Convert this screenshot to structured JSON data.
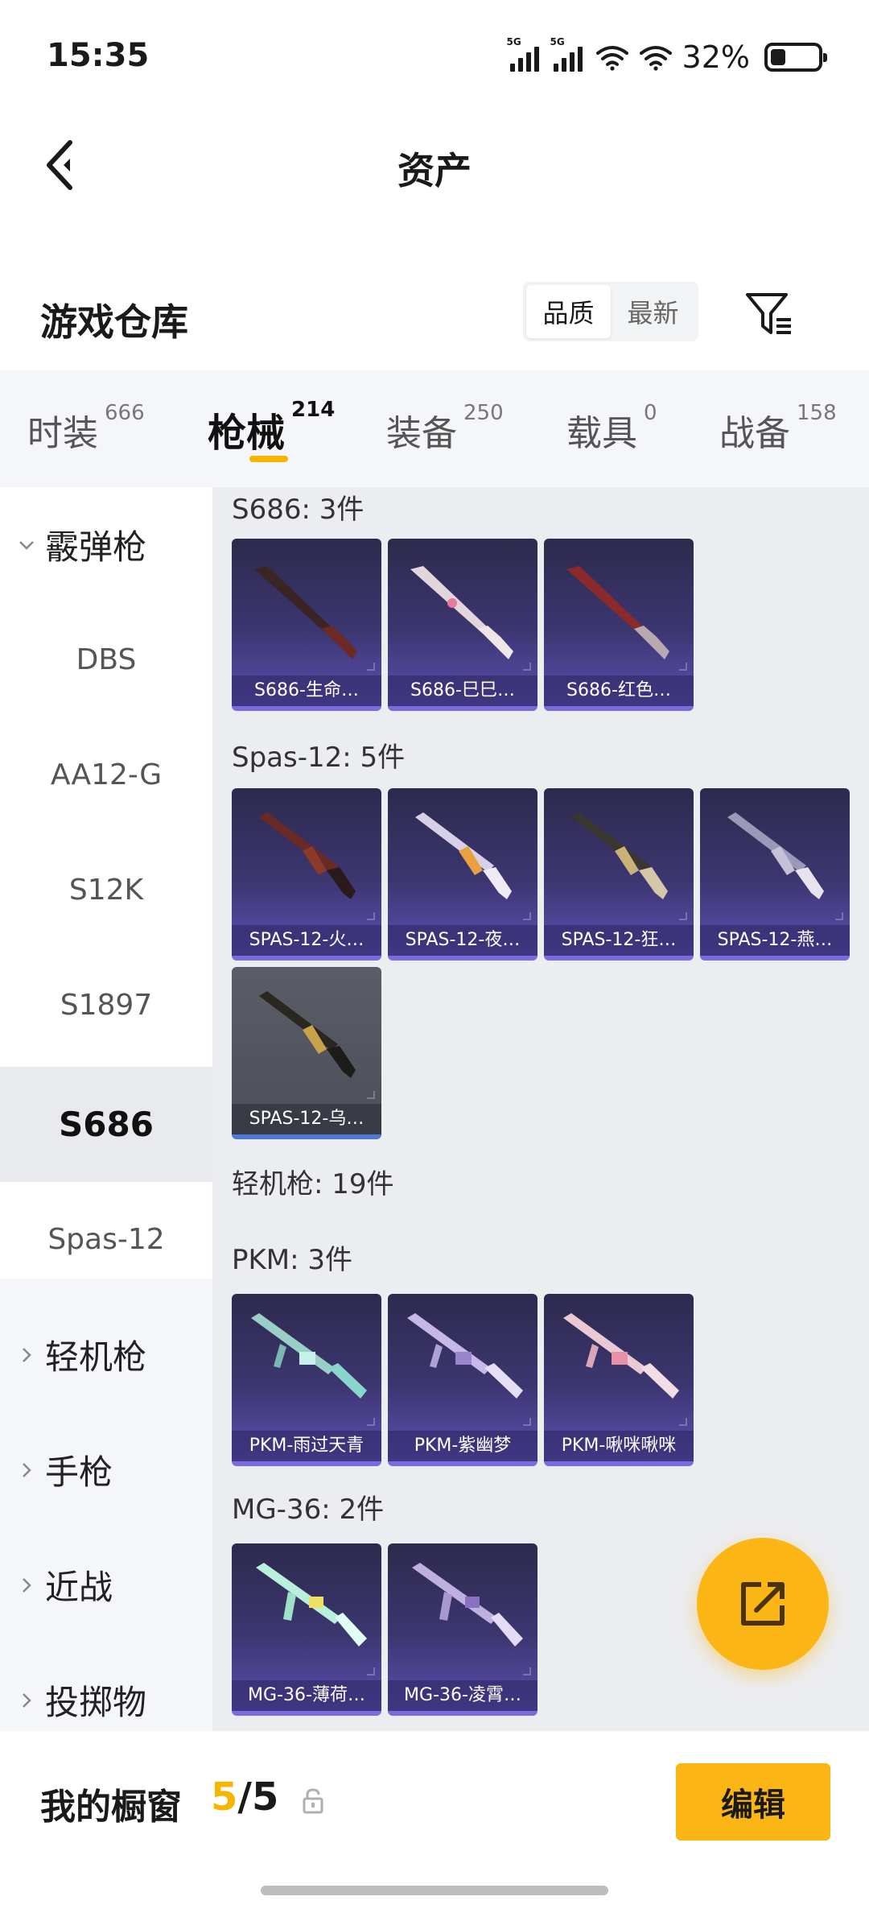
{
  "status_bar": {
    "time": "15:35",
    "network_1": "5G",
    "network_2": "5G",
    "battery_percent": "32%",
    "battery_level": 0.32
  },
  "nav": {
    "title": "资产",
    "back_icon": "chevron-left-icon"
  },
  "section": {
    "title": "游戏仓库",
    "sort_options": [
      "品质",
      "最新"
    ],
    "sort_selected": "品质",
    "filter_icon": "filter-icon"
  },
  "tabs": [
    {
      "name": "时装",
      "count": "666",
      "active": false
    },
    {
      "name": "枪械",
      "count": "214",
      "active": true
    },
    {
      "name": "装备",
      "count": "250",
      "active": false
    },
    {
      "name": "载具",
      "count": "0",
      "active": false
    },
    {
      "name": "战备",
      "count": "158",
      "active": false
    }
  ],
  "sidebar": {
    "items": [
      {
        "label": "霰弹枪",
        "type": "group",
        "expanded": true
      },
      {
        "label": "DBS",
        "type": "sub"
      },
      {
        "label": "AA12-G",
        "type": "sub"
      },
      {
        "label": "S12K",
        "type": "sub"
      },
      {
        "label": "S1897",
        "type": "sub"
      },
      {
        "label": "S686",
        "type": "sub",
        "selected": true
      },
      {
        "label": "Spas-12",
        "type": "sub"
      },
      {
        "label": "轻机枪",
        "type": "group",
        "expanded": false
      },
      {
        "label": "手枪",
        "type": "group",
        "expanded": false
      },
      {
        "label": "近战",
        "type": "group",
        "expanded": false
      },
      {
        "label": "投掷物",
        "type": "group",
        "expanded": false
      }
    ]
  },
  "content": {
    "groups": [
      {
        "title": "S686: 3件",
        "items": [
          "S686-生命…",
          "S686-巳巳…",
          "S686-红色…"
        ]
      },
      {
        "title": "Spas-12: 5件",
        "items": [
          "SPAS-12-火…",
          "SPAS-12-夜…",
          "SPAS-12-狂…",
          "SPAS-12-燕…",
          "SPAS-12-乌…"
        ]
      },
      {
        "title": "轻机枪: 19件",
        "items": []
      },
      {
        "title": "PKM: 3件",
        "items": [
          "PKM-雨过天青",
          "PKM-紫幽梦",
          "PKM-啾咪啾咪"
        ]
      },
      {
        "title": "MG-36: 2件",
        "items": [
          "MG-36-薄荷…",
          "MG-36-凌霄…"
        ]
      }
    ]
  },
  "fab": {
    "icon": "share-icon"
  },
  "bottom": {
    "showcase_label": "我的橱窗",
    "showcase_used": "5",
    "showcase_sep": "/",
    "showcase_total": "5",
    "lock_icon": "lock-icon",
    "edit_label": "编辑"
  },
  "colors": {
    "accent": "#f7b500",
    "fab": "#fbb615",
    "card_gradient_top": "#2d2a4d",
    "card_gradient_bottom": "#5e4fb4"
  }
}
